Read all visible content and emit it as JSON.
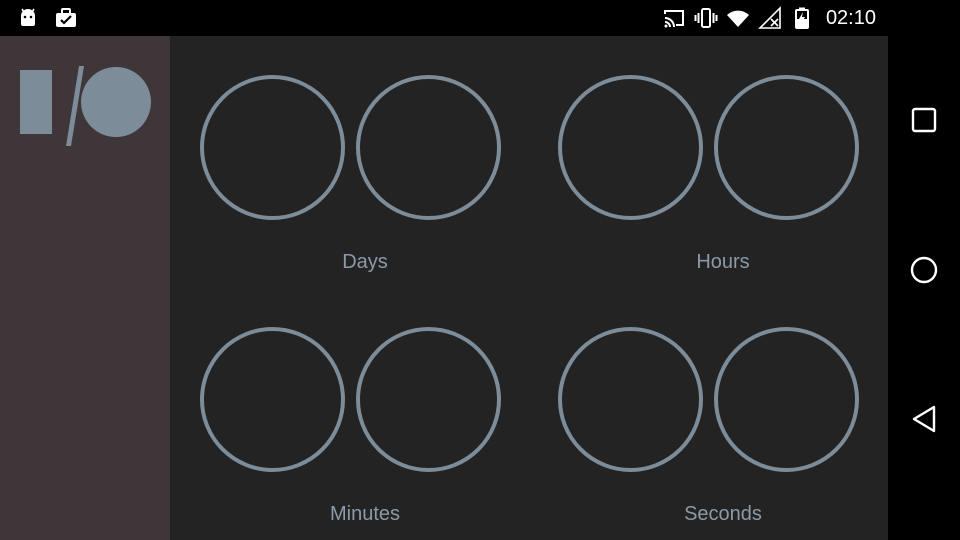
{
  "status_bar": {
    "time": "02:10",
    "left_icons": [
      "android-debug-icon",
      "briefcase-check-icon"
    ],
    "right_icons": [
      "cast-icon",
      "vibrate-icon",
      "wifi-icon",
      "no-signal-icon",
      "battery-charging-icon"
    ]
  },
  "countdown": {
    "units": [
      {
        "label": "Days"
      },
      {
        "label": "Hours"
      },
      {
        "label": "Minutes"
      },
      {
        "label": "Seconds"
      }
    ]
  },
  "colors": {
    "ring": "#7d8c99",
    "label": "#8b9aa6",
    "side_panel": "#3f3639",
    "main_panel": "#232323",
    "logo": "#7d8c99"
  },
  "nav_bar": {
    "buttons": [
      "recents-icon",
      "home-icon",
      "back-icon"
    ]
  }
}
